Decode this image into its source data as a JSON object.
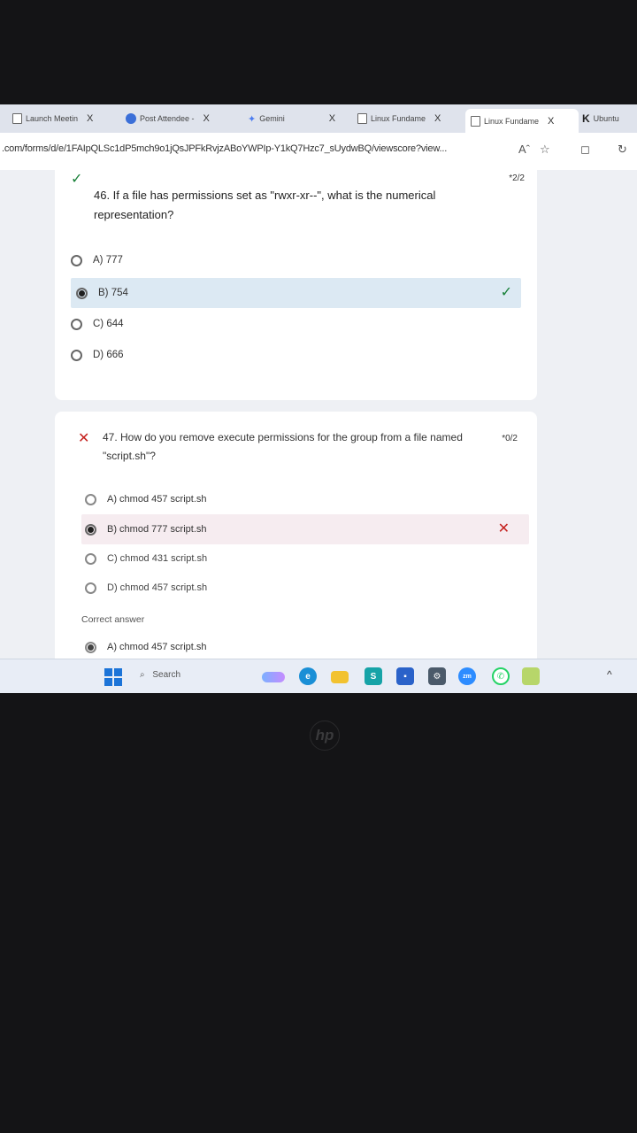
{
  "browser": {
    "tabs": [
      {
        "label": "Launch Meetin",
        "close": "X"
      },
      {
        "label": "Post Attendee -",
        "close": "X"
      },
      {
        "label": "Gemini",
        "close": "X"
      },
      {
        "label": "Linux Fundame",
        "close": "X"
      },
      {
        "label": "Linux Fundame",
        "close": "X"
      },
      {
        "label": "Ubuntu",
        "close": ""
      }
    ],
    "url": ".com/forms/d/e/1FAIpQLSc1dP5mch9o1jQsJPFkRvjzABoYWPIp-Y1kQ7Hzc7_sUydwBQ/viewscore?view...",
    "icons": [
      "read-aloud-icon",
      "star-icon",
      "collections-icon",
      "refresh-icon"
    ]
  },
  "questions": [
    {
      "status_mark": "✓",
      "text": "46. If a file has permissions set as \"rwxr-xr--\", what is the numerical representation?",
      "score": "*2/2",
      "options": [
        "A) 777",
        "B) 754",
        "C) 644",
        "D) 666"
      ],
      "selected": "B) 754",
      "result_mark": "✓"
    },
    {
      "status_mark": "✕",
      "text": "47. How do you remove execute permissions for the group from a file named \"script.sh\"?",
      "score": "*0/2",
      "options": [
        "A) chmod 457 script.sh",
        "B) chmod 777 script.sh",
        "C) chmod 431 script.sh",
        "D) chmod 457 script.sh"
      ],
      "selected": "B) chmod 777 script.sh",
      "result_mark": "✕",
      "correct_answer_label": "Correct answer",
      "correct_answer": "A) chmod 457 script.sh"
    }
  ],
  "taskbar": {
    "search_label": "Search",
    "apps": [
      "copilot-icon",
      "edge-icon",
      "file-explorer-icon",
      "sway-icon",
      "store-icon",
      "settings-icon",
      "zoom-icon",
      "whatsapp-icon",
      "notepad-icon"
    ],
    "tray": "^"
  },
  "bezel_logo": "hp",
  "colors": {
    "accent": "#1c74d8",
    "correct_bg": "#dce9f3",
    "wrong_bg": "#f6ecf0",
    "wrong": "#c5221f",
    "correct": "#188038"
  }
}
